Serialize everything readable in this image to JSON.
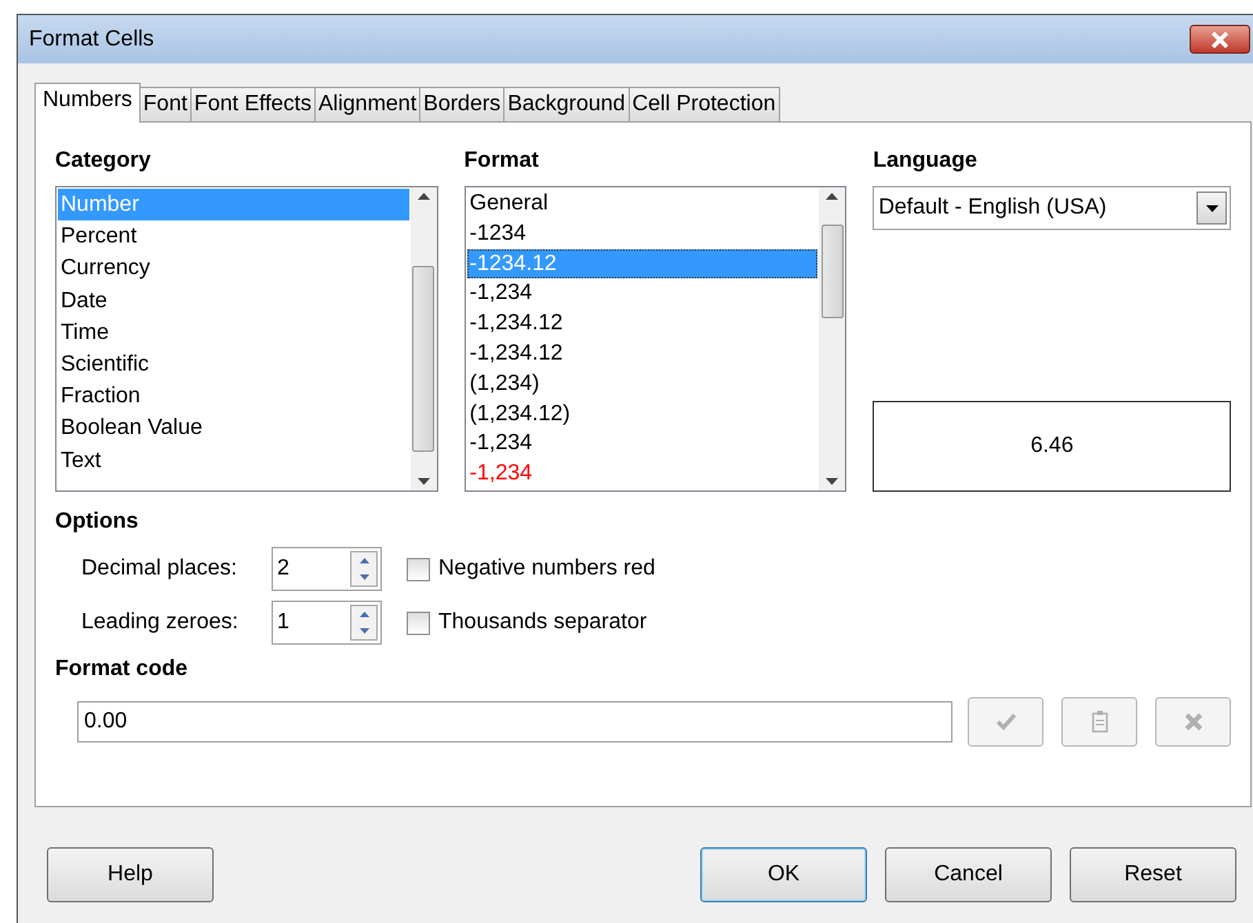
{
  "window": {
    "title": "Format Cells"
  },
  "tabs": [
    {
      "label": "Numbers",
      "selected": true
    },
    {
      "label": "Font",
      "selected": false
    },
    {
      "label": "Font Effects",
      "selected": false
    },
    {
      "label": "Alignment",
      "selected": false
    },
    {
      "label": "Borders",
      "selected": false
    },
    {
      "label": "Background",
      "selected": false
    },
    {
      "label": "Cell Protection",
      "selected": false
    }
  ],
  "category": {
    "label": "Category",
    "items": [
      {
        "label": "Number",
        "selected": true
      },
      {
        "label": "Percent",
        "selected": false
      },
      {
        "label": "Currency",
        "selected": false
      },
      {
        "label": "Date",
        "selected": false
      },
      {
        "label": "Time",
        "selected": false
      },
      {
        "label": "Scientific",
        "selected": false
      },
      {
        "label": "Fraction",
        "selected": false
      },
      {
        "label": "Boolean Value",
        "selected": false
      },
      {
        "label": "Text",
        "selected": false
      }
    ]
  },
  "format": {
    "label": "Format",
    "items": [
      {
        "label": "General",
        "selected": false,
        "kind": "plain"
      },
      {
        "label": "-1234",
        "selected": false,
        "kind": "plain"
      },
      {
        "label": "-1234.12",
        "selected": true,
        "kind": "plain"
      },
      {
        "label": "-1,234",
        "selected": false,
        "kind": "plain"
      },
      {
        "label": "-1,234.12",
        "selected": false,
        "kind": "plain"
      },
      {
        "label": "-1,234.12",
        "selected": false,
        "kind": "plain"
      },
      {
        "label": "(1,234)",
        "selected": false,
        "kind": "plain"
      },
      {
        "label": "(1,234.12)",
        "selected": false,
        "kind": "plain"
      },
      {
        "label": "-1,234",
        "selected": false,
        "kind": "plain"
      },
      {
        "label": "-1,234",
        "selected": false,
        "kind": "negative"
      }
    ]
  },
  "language": {
    "label": "Language",
    "value": "Default - English (USA)"
  },
  "preview": "6.46",
  "options": {
    "label": "Options",
    "rows": [
      {
        "label": "Decimal places:",
        "value": "2",
        "checkbox": {
          "label": "Negative numbers red",
          "checked": false
        }
      },
      {
        "label": "Leading zeroes:",
        "value": "1",
        "checkbox": {
          "label": "Thousands separator",
          "checked": false
        }
      }
    ]
  },
  "format_code": {
    "label": "Format code",
    "value": "0.00",
    "buttons": [
      {
        "kind": "accept",
        "disabled": true
      },
      {
        "kind": "comment",
        "disabled": true
      },
      {
        "kind": "delete",
        "disabled": true
      }
    ]
  },
  "buttons": [
    {
      "label": "Help",
      "default": false
    },
    {
      "label": "OK",
      "default": true
    },
    {
      "label": "Cancel",
      "default": false
    },
    {
      "label": "Reset",
      "default": false
    }
  ]
}
